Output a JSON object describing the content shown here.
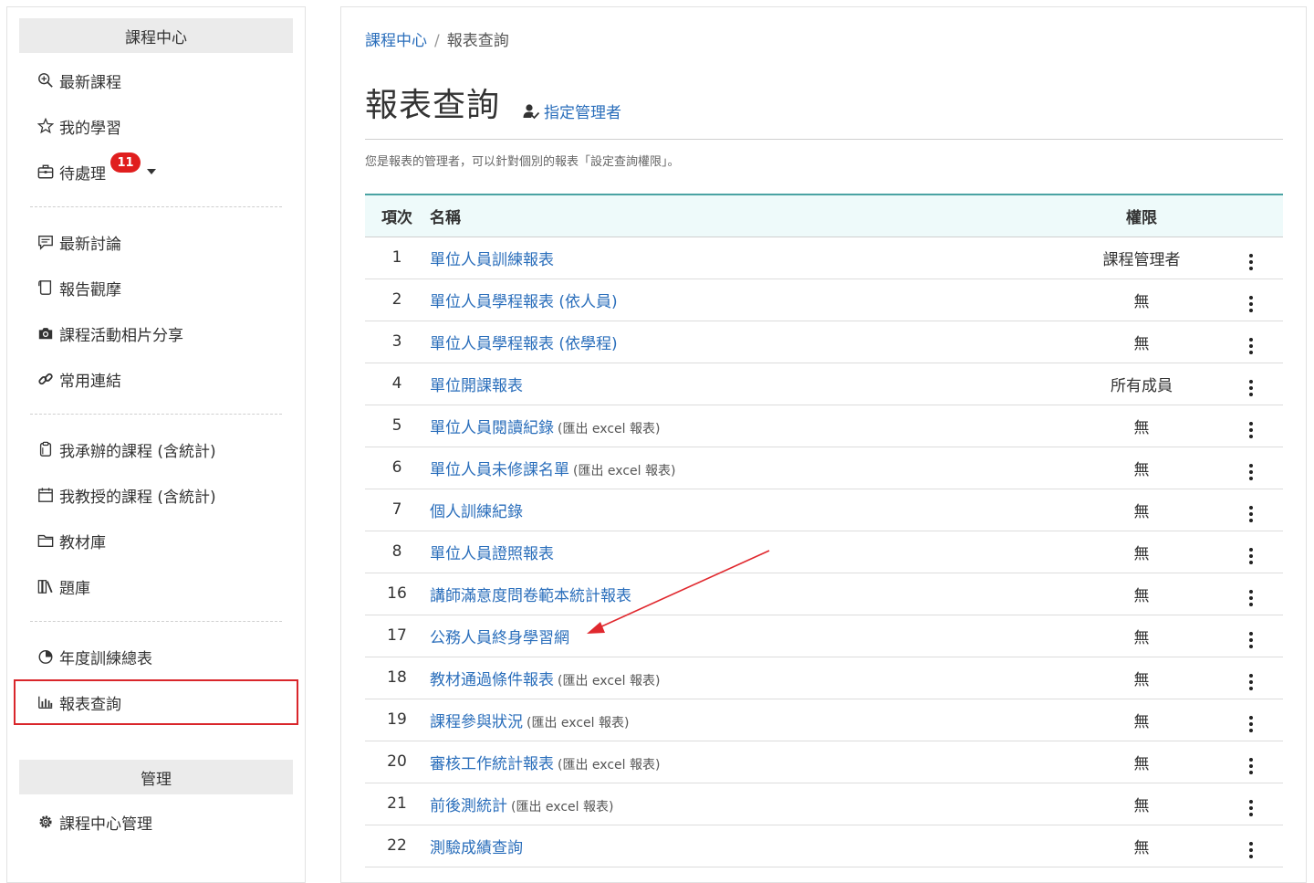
{
  "sidebar": {
    "header": "課程中心",
    "items": [
      {
        "label": "最新課程",
        "icon": "search-plus-icon"
      },
      {
        "label": "我的學習",
        "icon": "star-icon"
      },
      {
        "label": "待處理",
        "icon": "briefcase-icon",
        "badge": "11"
      },
      {
        "label": "最新討論",
        "icon": "comment-icon"
      },
      {
        "label": "報告觀摩",
        "icon": "scroll-icon"
      },
      {
        "label": "課程活動相片分享",
        "icon": "camera-icon"
      },
      {
        "label": "常用連結",
        "icon": "link-icon"
      },
      {
        "label": "我承辦的課程 (含統計)",
        "icon": "clipboard-icon"
      },
      {
        "label": "我教授的課程 (含統計)",
        "icon": "calendar-icon"
      },
      {
        "label": "教材庫",
        "icon": "folder-icon"
      },
      {
        "label": "題庫",
        "icon": "books-icon"
      },
      {
        "label": "年度訓練總表",
        "icon": "pie-chart-icon"
      },
      {
        "label": "報表查詢",
        "icon": "bar-chart-icon"
      }
    ],
    "admin_header": "管理",
    "admin_items": [
      {
        "label": "課程中心管理",
        "icon": "gear-icon"
      }
    ]
  },
  "main": {
    "breadcrumb": {
      "root": "課程中心",
      "current": "報表查詢"
    },
    "title": "報表查詢",
    "assign_link": "指定管理者",
    "description": "您是報表的管理者，可以針對個別的報表「設定查詢權限」。",
    "table": {
      "headers": {
        "no": "項次",
        "name": "名稱",
        "perm": "權限"
      },
      "rows": [
        {
          "no": "1",
          "name": "單位人員訓練報表",
          "note": "",
          "perm": "課程管理者"
        },
        {
          "no": "2",
          "name": "單位人員學程報表 (依人員)",
          "note": "",
          "perm": "無"
        },
        {
          "no": "3",
          "name": "單位人員學程報表 (依學程)",
          "note": "",
          "perm": "無"
        },
        {
          "no": "4",
          "name": "單位開課報表",
          "note": "",
          "perm": "所有成員"
        },
        {
          "no": "5",
          "name": "單位人員閱讀紀錄",
          "note": "(匯出 excel 報表)",
          "perm": "無"
        },
        {
          "no": "6",
          "name": "單位人員未修課名單",
          "note": "(匯出 excel 報表)",
          "perm": "無"
        },
        {
          "no": "7",
          "name": "個人訓練紀錄",
          "note": "",
          "perm": "無"
        },
        {
          "no": "8",
          "name": "單位人員證照報表",
          "note": "",
          "perm": "無"
        },
        {
          "no": "16",
          "name": "講師滿意度問卷範本統計報表",
          "note": "",
          "perm": "無"
        },
        {
          "no": "17",
          "name": "公務人員終身學習網",
          "note": "",
          "perm": "無"
        },
        {
          "no": "18",
          "name": "教材通過條件報表",
          "note": "(匯出 excel 報表)",
          "perm": "無"
        },
        {
          "no": "19",
          "name": "課程參與狀況",
          "note": "(匯出 excel 報表)",
          "perm": "無"
        },
        {
          "no": "20",
          "name": "審核工作統計報表",
          "note": "(匯出 excel 報表)",
          "perm": "無"
        },
        {
          "no": "21",
          "name": "前後測統計",
          "note": "(匯出 excel 報表)",
          "perm": "無"
        },
        {
          "no": "22",
          "name": "測驗成績查詢",
          "note": "",
          "perm": "無"
        }
      ]
    }
  },
  "colors": {
    "link": "#2a6ebb",
    "badge": "#e01e1e",
    "highlight_box": "#d9262b",
    "table_accent": "#4aa3a3",
    "annotation_arrow": "#e0282e"
  }
}
